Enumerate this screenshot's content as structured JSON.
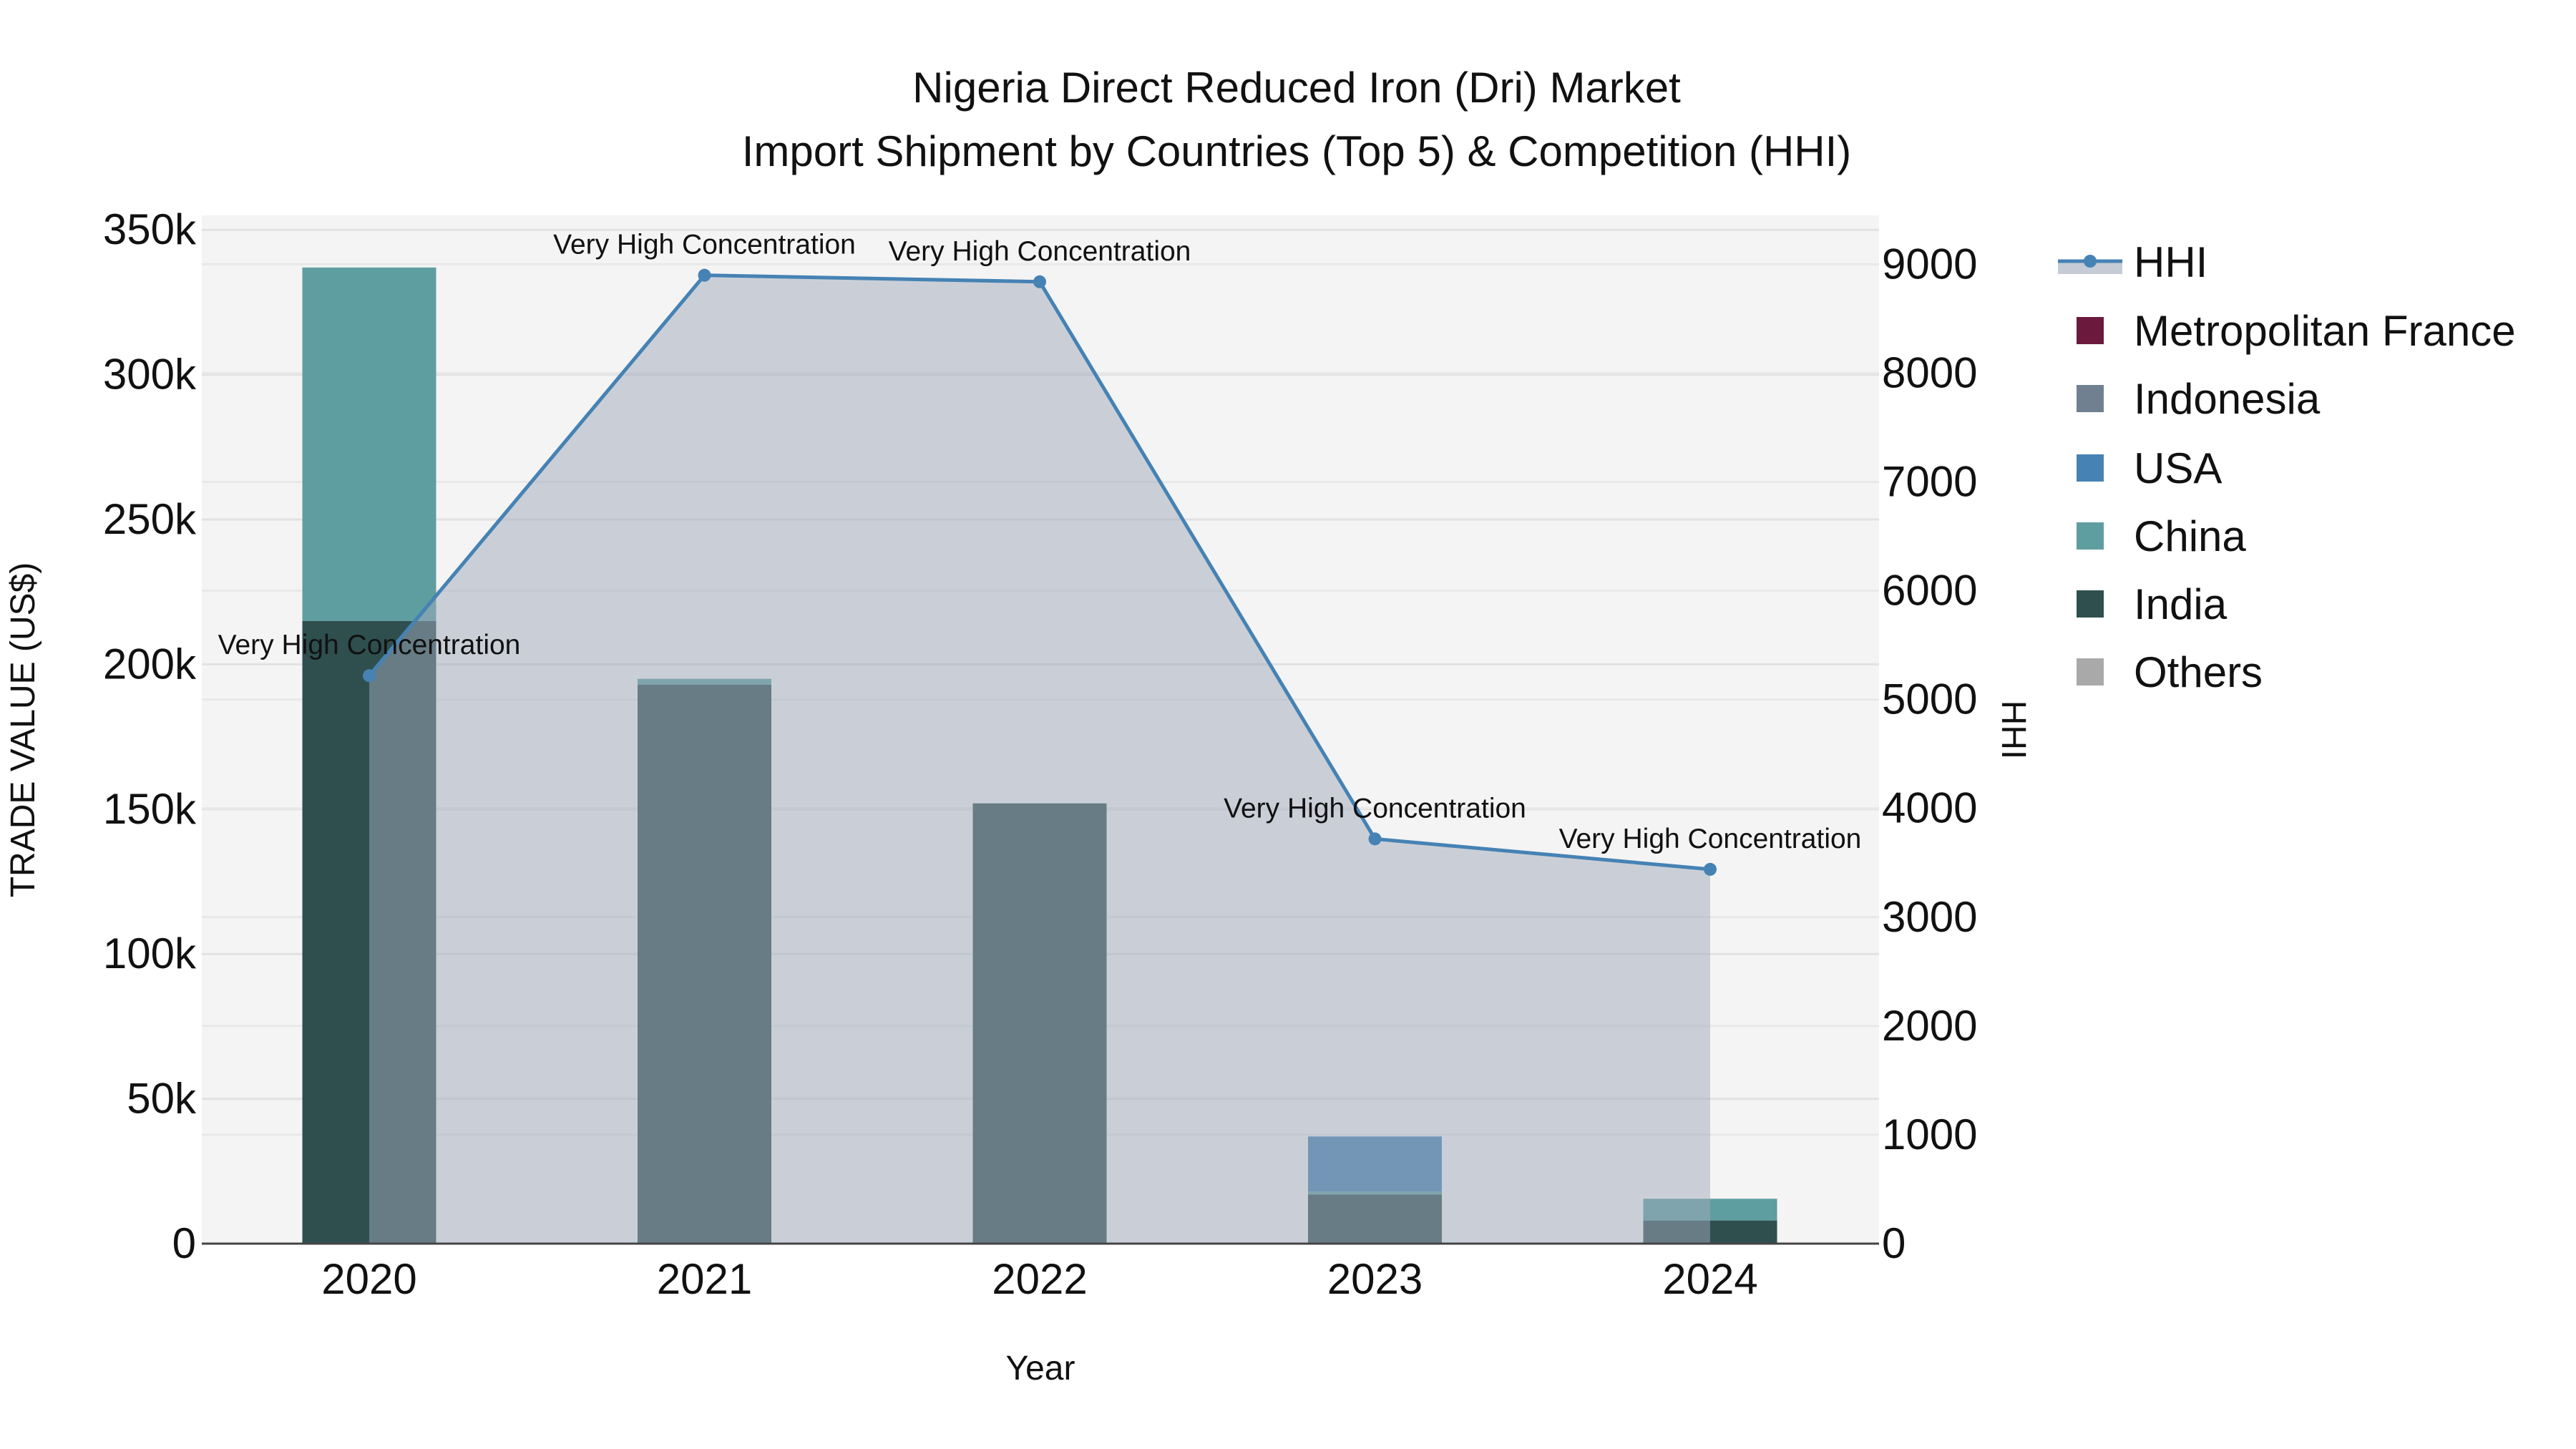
{
  "chart_data": {
    "type": "bar+line",
    "title_line1": "Nigeria Direct Reduced Iron (Dri) Market",
    "title_line2": "Import Shipment by Countries (Top 5) & Competition (HHI)",
    "xlabel": "Year",
    "ylabel": "TRADE VALUE (US$)",
    "y2label": "HHI",
    "categories": [
      "2020",
      "2021",
      "2022",
      "2023",
      "2024"
    ],
    "ylim": [
      0,
      355000
    ],
    "y2lim": [
      0,
      9450
    ],
    "yticks": [
      0,
      50000,
      100000,
      150000,
      200000,
      250000,
      300000,
      350000
    ],
    "ytick_labels": [
      "0",
      "50k",
      "100k",
      "150k",
      "200k",
      "250k",
      "300k",
      "350k"
    ],
    "y2ticks": [
      0,
      1000,
      2000,
      3000,
      4000,
      5000,
      6000,
      7000,
      8000,
      9000
    ],
    "y2tick_labels": [
      "0",
      "1000",
      "2000",
      "3000",
      "4000",
      "5000",
      "6000",
      "7000",
      "8000",
      "9000"
    ],
    "barmode": "stack",
    "series": [
      {
        "name": "India",
        "color": "#2f4f4f",
        "values": [
          215000,
          193000,
          152000,
          17000,
          8000
        ]
      },
      {
        "name": "China",
        "color": "#5f9ea0",
        "values": [
          122000,
          2000,
          0,
          1000,
          7500
        ]
      },
      {
        "name": "USA",
        "color": "#4682b4",
        "values": [
          0,
          0,
          0,
          19000,
          0
        ]
      },
      {
        "name": "Indonesia",
        "color": "#708090",
        "values": [
          0,
          0,
          0,
          0,
          0
        ]
      },
      {
        "name": "Metropolitan France",
        "color": "#6b1a3d",
        "values": [
          0,
          0,
          0,
          0,
          0
        ]
      },
      {
        "name": "Others",
        "color": "#a9a9a9",
        "values": [
          0,
          0,
          0,
          0,
          0
        ]
      }
    ],
    "hhi": {
      "name": "HHI",
      "color": "#4682b4",
      "fill": "rgba(160,170,185,0.5)",
      "values": [
        5220,
        8900,
        8840,
        3720,
        3440
      ],
      "annotations": [
        "Very High Concentration",
        "Very High Concentration",
        "Very High Concentration",
        "Very High Concentration",
        "Very High Concentration"
      ]
    },
    "legend": {
      "placement": "right",
      "entries": [
        "HHI",
        "Metropolitan France",
        "Indonesia",
        "USA",
        "China",
        "India",
        "Others"
      ],
      "colors": [
        "#4682b4",
        "#6b1a3d",
        "#708090",
        "#4682b4",
        "#5f9ea0",
        "#2f4f4f",
        "#a9a9a9"
      ]
    },
    "grid": true
  }
}
